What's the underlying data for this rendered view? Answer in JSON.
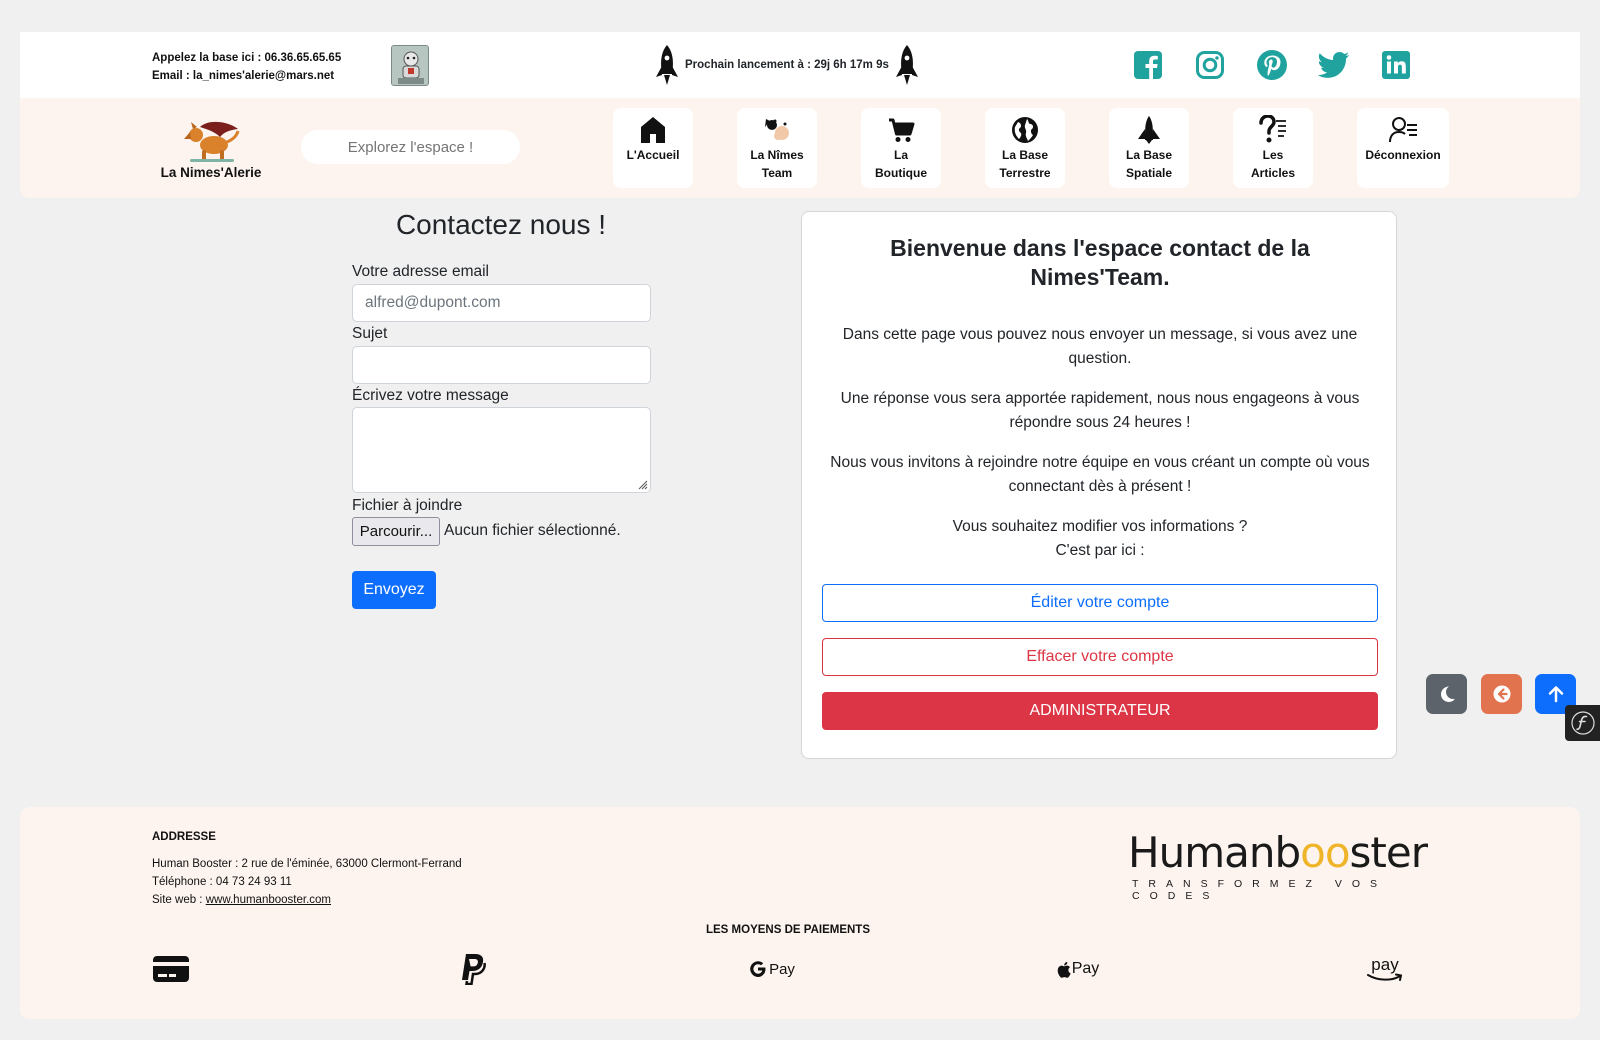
{
  "topbar": {
    "phone_line": "Appelez la base ici : 06.36.65.65.65",
    "email_line": "Email : la_nimes'alerie@mars.net",
    "launch_text": "Prochain lancement à : 29j 6h 17m 9s",
    "socials": [
      "facebook-icon",
      "instagram-icon",
      "pinterest-icon",
      "twitter-icon",
      "linkedin-icon"
    ],
    "social_color": "#20a39e"
  },
  "navbar": {
    "brand_name": "La Nimes'Alerie",
    "search_placeholder": "Explorez l'espace !",
    "items": [
      {
        "line1": "L'Accueil",
        "line2": "",
        "icon": "home-icon"
      },
      {
        "line1": "La Nîmes",
        "line2": "Team",
        "icon": "team-icon"
      },
      {
        "line1": "La",
        "line2": "Boutique",
        "icon": "cart-icon"
      },
      {
        "line1": "La Base",
        "line2": "Terrestre",
        "icon": "earth-icon"
      },
      {
        "line1": "La Base",
        "line2": "Spatiale",
        "icon": "shuttle-icon"
      },
      {
        "line1": "Les",
        "line2": "Articles",
        "icon": "articles-icon"
      },
      {
        "line1": "Déconnexion",
        "line2": "",
        "icon": "user-logout-icon"
      }
    ]
  },
  "form": {
    "title": "Contactez nous !",
    "email_label": "Votre adresse email",
    "email_placeholder": "alfred@dupont.com",
    "subject_label": "Sujet",
    "message_label": "Écrivez votre message",
    "file_label": "Fichier à joindre",
    "file_button": "Parcourir...",
    "file_status": "Aucun fichier sélectionné.",
    "submit": "Envoyez"
  },
  "card": {
    "title": "Bienvenue dans l'espace contact de la Nimes'Team.",
    "p1": "Dans cette page vous pouvez nous envoyer un message, si vous avez une question.",
    "p2": "Une réponse vous sera apportée rapidement, nous nous engageons à vous répondre sous 24 heures !",
    "p3": "Nous vous invitons à rejoindre notre équipe en vous créant un compte où vous connectant dès à présent !",
    "p4a": "Vous souhaitez modifier vos informations ?",
    "p4b": "C'est par ici :",
    "btn_edit": "Éditer votre compte",
    "btn_delete": "Effacer votre compte",
    "btn_admin": "ADMINISTRATEUR"
  },
  "floating": [
    "moon-icon",
    "back-arrow-icon",
    "arrow-up-icon",
    "symfony-icon"
  ],
  "footer": {
    "address_title": "ADDRESSE",
    "address_line": "Human Booster : 2 rue de l'éminée, 63000 Clermont-Ferrand",
    "phone_line": "Téléphone : 04 73 24 93 11",
    "site_prefix": "Site web : ",
    "site_link": "www.humanbooster.com",
    "logo_word_a": "Humanb",
    "logo_word_oo": "oo",
    "logo_word_b": "ster",
    "logo_tagline": "TRANSFORMEZ VOS CODES",
    "payments_title": "LES MOYENS DE PAIEMENTS",
    "payments": [
      "credit-card-icon",
      "paypal-icon",
      "google-pay-icon",
      "apple-pay-icon",
      "amazon-pay-icon"
    ],
    "gpay_label": "Pay",
    "applepay_label": "Pay",
    "amazonpay_label": "pay"
  },
  "colors": {
    "primary": "#0d6efd",
    "danger": "#dc3545",
    "nav_background": "#fdf4ef",
    "page_background": "#f0f0f0"
  }
}
